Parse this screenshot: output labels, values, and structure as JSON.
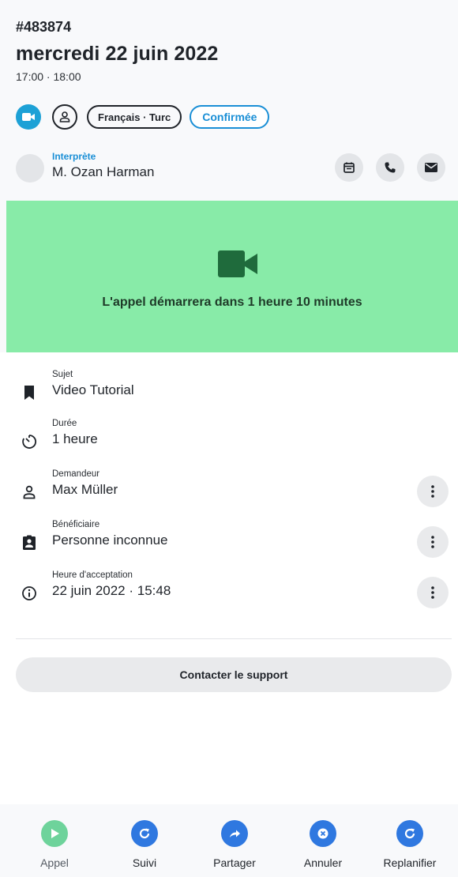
{
  "header": {
    "ref": "#483874",
    "date": "mercredi 22 juin 2022",
    "time": "17:00 · 18:00",
    "language_chip": "Français · Turc",
    "status_chip": "Confirmée"
  },
  "interpreter": {
    "label": "Interprète",
    "name": "M. Ozan Harman"
  },
  "banner": {
    "message": "L'appel démarrera dans 1 heure 10 minutes"
  },
  "details": [
    {
      "label": "Sujet",
      "value": "Video Tutorial",
      "icon": "bookmark-icon"
    },
    {
      "label": "Durée",
      "value": "1 heure",
      "icon": "timer-icon"
    },
    {
      "label": "Demandeur",
      "value": "Max Müller",
      "icon": "person-icon"
    },
    {
      "label": "Bénéficiaire",
      "value": "Personne inconnue",
      "icon": "badge-icon"
    },
    {
      "label": "Heure d'acceptation",
      "value": "22 juin 2022 · 15:48",
      "icon": "info-icon"
    }
  ],
  "support_label": "Contacter le support",
  "nav": [
    {
      "label": "Appel",
      "icon": "play-icon"
    },
    {
      "label": "Suivi",
      "icon": "refresh-icon"
    },
    {
      "label": "Partager",
      "icon": "share-icon"
    },
    {
      "label": "Annuler",
      "icon": "cancel-icon"
    },
    {
      "label": "Replanifier",
      "icon": "reschedule-icon"
    }
  ],
  "colors": {
    "accent": "#1a8fd6",
    "video_chip": "#1da1d6",
    "banner_bg": "#88eba8",
    "banner_icon": "#1f6b3c",
    "call_button": "#6ed39b",
    "nav_button": "#2f78e0"
  }
}
